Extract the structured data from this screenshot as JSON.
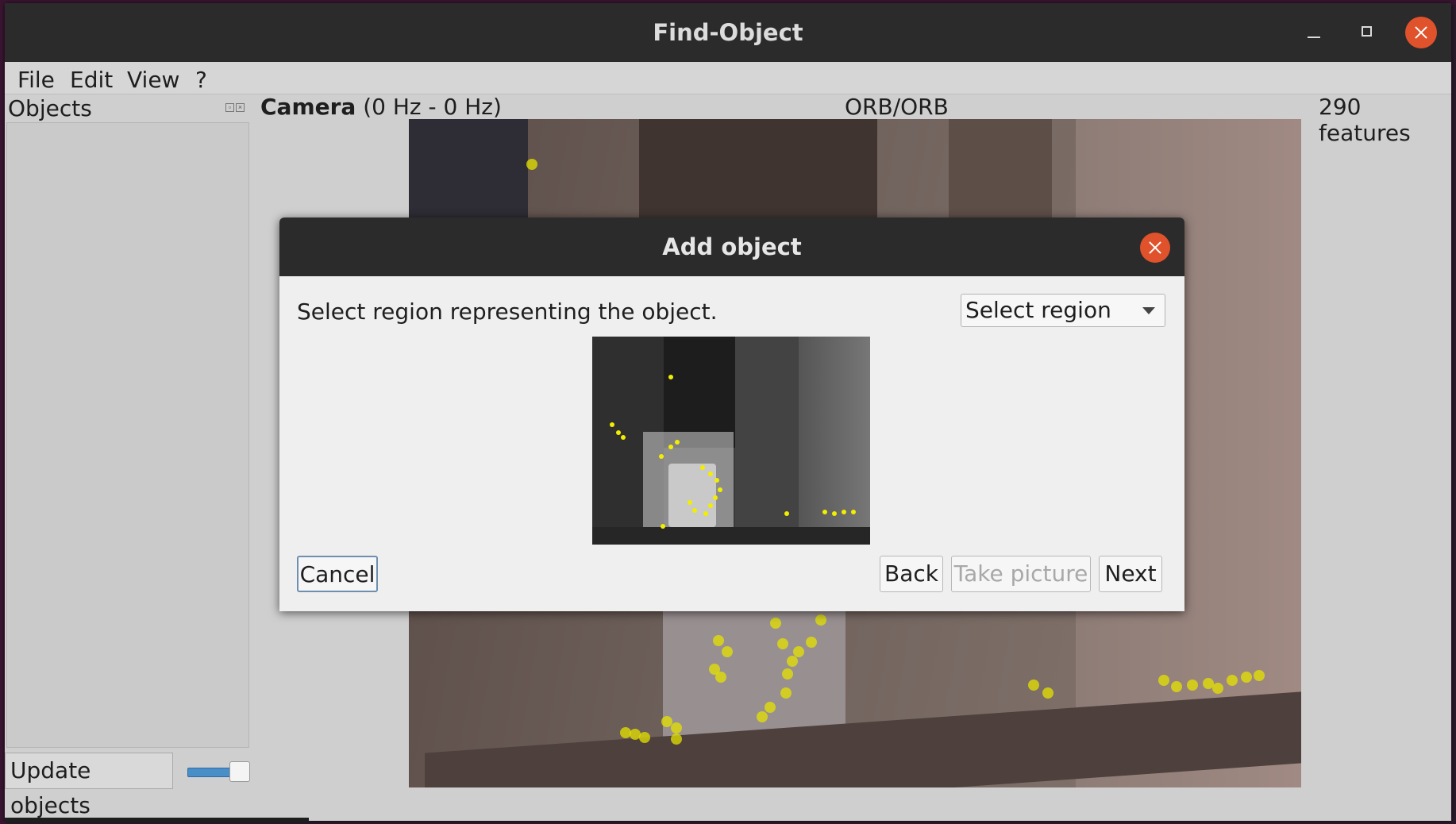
{
  "window": {
    "title": "Find-Object"
  },
  "menubar": {
    "items": [
      "File",
      "Edit",
      "View",
      "?"
    ]
  },
  "objects_dock": {
    "title": "Objects",
    "update_button_label": "Update objects",
    "slider_value_fraction": 0.75
  },
  "camera": {
    "title": "Camera",
    "rate": "(0 Hz - 0 Hz)",
    "detector": "ORB/ORB",
    "features": "290 features"
  },
  "dialog": {
    "title": "Add object",
    "instruction": "Select region representing the object.",
    "select": {
      "value": "Select region"
    },
    "buttons": {
      "cancel": "Cancel",
      "back": "Back",
      "take_picture": "Take picture",
      "next": "Next"
    }
  },
  "colors": {
    "titlebar": "#2b2b2b",
    "close_button": "#e0522b",
    "feature_points": "#f2ee00",
    "slider_fill": "#4a8ec8"
  }
}
